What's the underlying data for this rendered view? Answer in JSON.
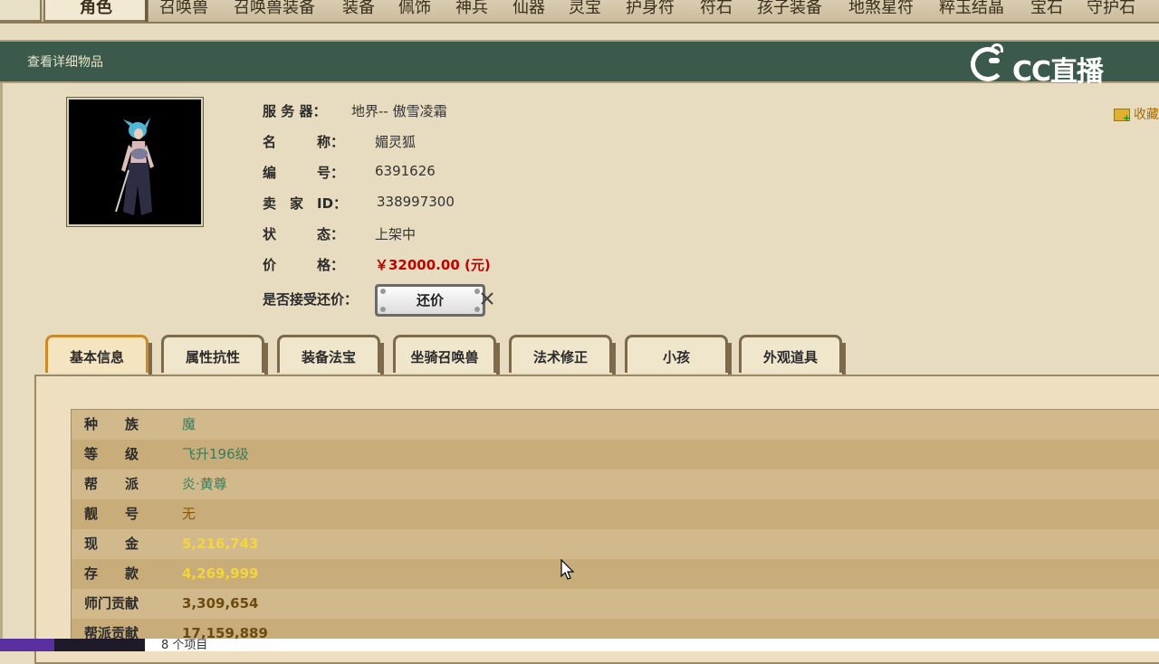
{
  "top_tabs": [
    "角色",
    "召唤兽",
    "召唤兽装备",
    "装备",
    "佩饰",
    "神兵",
    "仙器",
    "灵宝",
    "护身符",
    "符石",
    "孩子装备",
    "地煞星符",
    "粹玉结晶",
    "宝石",
    "守护石"
  ],
  "header": {
    "title": "查看详细物品",
    "logo_text": "CC直播"
  },
  "favorite": "收藏",
  "info": {
    "server_label": "服 务 器：",
    "server_value": "地界-- 傲雪凌霜",
    "name_label": "名　　　称：",
    "name_value": "媚灵狐",
    "id_label": "编　　　号：",
    "id_value": "6391626",
    "seller_label": "卖　家　ID：",
    "seller_value": "338997300",
    "status_label": "状　　　态：",
    "status_value": "上架中",
    "price_label": "价　　　格：",
    "price_value": "￥32000.00 (元)",
    "counter_label": "是否接受还价：",
    "counter_button": "还价"
  },
  "detail_tabs": [
    "基本信息",
    "属性抗性",
    "装备法宝",
    "坐骑召唤兽",
    "法术修正",
    "小孩",
    "外观道具"
  ],
  "basic_info": [
    {
      "k": "种　　族",
      "v": "魔"
    },
    {
      "k": "等　　级",
      "v": "飞升196级"
    },
    {
      "k": "帮　　派",
      "v": "炎·黄尊"
    },
    {
      "k": "靓　　号",
      "v": "无"
    },
    {
      "k": "现　　金",
      "v": "5,216,743"
    },
    {
      "k": "存　　款",
      "v": "4,269,999"
    },
    {
      "k": "师门贡献",
      "v": "3,309,654"
    },
    {
      "k": "帮派贡献",
      "v": "17,159,889"
    }
  ],
  "footer": {
    "item_count": "8 个项目"
  },
  "colors": {
    "header_green": "#3b5a4b",
    "price_red": "#c10000",
    "accent_tab": "#c98a28"
  }
}
